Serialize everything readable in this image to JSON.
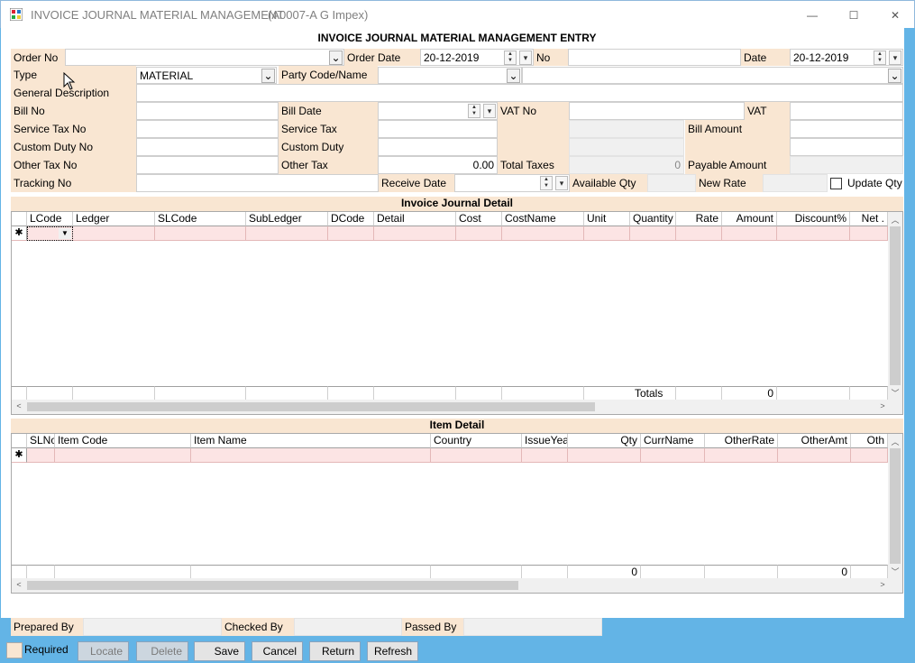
{
  "window": {
    "title": "INVOICE JOURNAL MATERIAL MANAGEMENT",
    "subtitle": "(A0007-A G Impex)",
    "minimize": "—",
    "maximize": "☐",
    "close": "✕"
  },
  "form": {
    "heading": "INVOICE JOURNAL MATERIAL MANAGEMENT ENTRY",
    "order_no_label": "Order No",
    "order_no": "",
    "order_date_label": "Order Date",
    "order_date": "20-12-2019",
    "no_label": "No",
    "no": "",
    "date_label": "Date",
    "date": "20-12-2019",
    "type_label": "Type",
    "type": "MATERIAL",
    "party_label": "Party Code/Name",
    "party_code": "",
    "party_name": "",
    "gen_desc_label": "General Description",
    "gen_desc": "",
    "bill_no_label": "Bill No",
    "bill_no": "",
    "bill_date_label": "Bill Date",
    "bill_date": "",
    "vat_no_label": "VAT No",
    "vat_no": "",
    "vat_label": "VAT",
    "vat": "",
    "svc_tax_no_label": "Service Tax No",
    "svc_tax_no": "",
    "svc_tax_label": "Service Tax",
    "svc_tax": "",
    "bill_amount_label": "Bill Amount",
    "bill_amount": "",
    "custom_duty_no_label": "Custom Duty No",
    "custom_duty_no": "",
    "custom_duty_label": "Custom Duty",
    "custom_duty": "",
    "other_tax_no_label": "Other Tax No",
    "other_tax_no": "",
    "other_tax_label": "Other Tax",
    "other_tax": "0.00",
    "total_taxes_label": "Total Taxes",
    "total_taxes": "0",
    "payable_label": "Payable Amount",
    "payable": "",
    "tracking_label": "Tracking No",
    "tracking": "",
    "receive_date_label": "Receive Date",
    "receive_date": "",
    "avail_qty_label": "Available Qty",
    "avail_qty": "",
    "new_rate_label": "New Rate",
    "new_rate": "",
    "update_qty_label": "Update Qty"
  },
  "journal": {
    "title": "Invoice Journal Detail",
    "columns": [
      "LCode",
      "Ledger",
      "SLCode",
      "SubLedger",
      "DCode",
      "Detail",
      "Cost",
      "CostName",
      "Unit",
      "Quantity",
      "Rate",
      "Amount",
      "Discount%",
      "Net ."
    ],
    "totals_label": "Totals",
    "totals_amount": "0",
    "new_row_marker": "✱"
  },
  "items": {
    "title": "Item Detail",
    "columns": [
      "SLNo",
      "Item Code",
      "Item Name",
      "Country",
      "IssueYear",
      "Qty",
      "CurrName",
      "OtherRate",
      "OtherAmt",
      "Oth"
    ],
    "total_qty": "0",
    "total_other": "0",
    "new_row_marker": "✱"
  },
  "footer": {
    "prepared_label": "Prepared By",
    "prepared": "",
    "checked_label": "Checked By",
    "checked": "",
    "passed_label": "Passed By",
    "passed": ""
  },
  "buttons": {
    "required": "Required",
    "locate": "Locate",
    "delete": "Delete",
    "save": "Save",
    "cancel": "Cancel",
    "return": "Return",
    "refresh": "Refresh"
  }
}
